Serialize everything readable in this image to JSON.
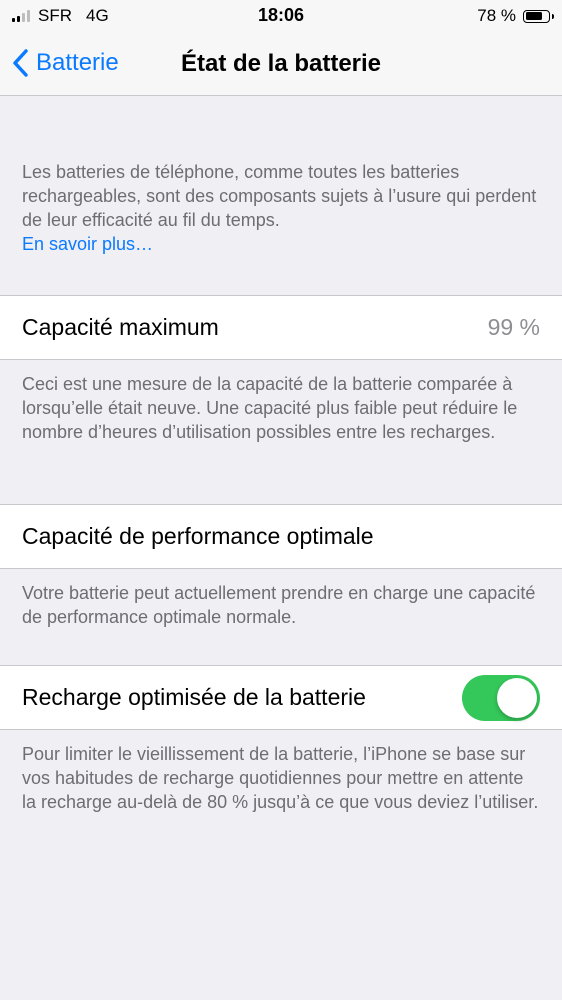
{
  "status_bar": {
    "carrier": "SFR",
    "network": "4G",
    "time": "18:06",
    "battery_percent": "78 %",
    "battery_level": 0.78
  },
  "nav": {
    "back_label": "Batterie",
    "title": "État de la batterie"
  },
  "intro": {
    "text": "Les batteries de téléphone, comme toutes les batteries rechargeables, sont des composants sujets à l’usure qui perdent de leur efficacité au fil du temps.",
    "link": "En savoir plus…"
  },
  "max_capacity": {
    "label": "Capacité maximum",
    "value": "99 %",
    "footer": "Ceci est une mesure de la capacité de la batterie comparée à lorsqu’elle était neuve. Une capacité plus faible peut réduire le nombre d’heures d’utilisation possibles entre les recharges."
  },
  "peak_performance": {
    "label": "Capacité de performance optimale",
    "footer": "Votre batterie peut actuellement prendre en charge une capacité de performance optimale normale."
  },
  "optimized_charging": {
    "label": "Recharge optimisée de la batterie",
    "enabled": true,
    "footer": "Pour limiter le vieillissement de la batterie, l’iPhone se base sur vos habitudes de recharge quotidiennes pour mettre en attente la recharge au-delà de 80 % jusqu’à ce que vous deviez l’utiliser."
  },
  "colors": {
    "accent": "#0a7aff",
    "toggle_on": "#34c759",
    "background": "#efeff4",
    "secondary_text": "#6d6d72"
  }
}
